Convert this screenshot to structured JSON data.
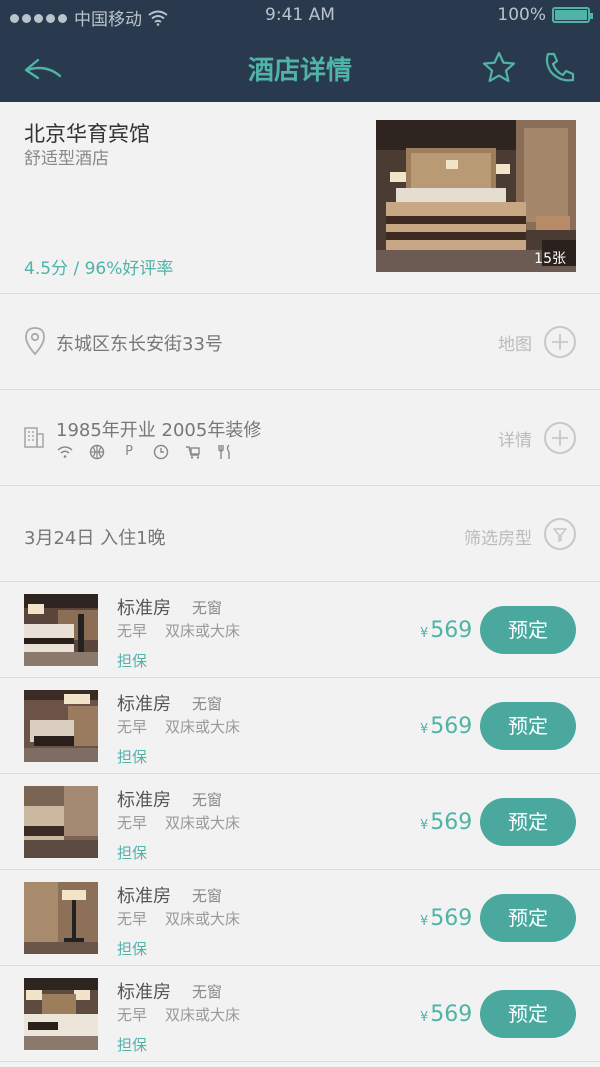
{
  "status_bar": {
    "carrier": "中国移动",
    "time": "9:41 AM",
    "battery": "100%"
  },
  "nav": {
    "title": "酒店详情",
    "back_icon": "back-arrow-icon",
    "favorite_icon": "star-icon",
    "call_icon": "phone-icon"
  },
  "hotel": {
    "name": "北京华育宾馆",
    "type": "舒适型酒店",
    "rating": "4.5分 / 96%好评率",
    "photo_count": "15张"
  },
  "address": {
    "text": "东城区东长安街33号",
    "action": "地图"
  },
  "facility": {
    "text": "1985年开业  2005年装修",
    "action": "详情",
    "amenities": [
      "wifi-icon",
      "globe-icon",
      "parking-icon",
      "clock-icon",
      "luggage-icon",
      "restaurant-icon"
    ],
    "parking_label": "P"
  },
  "filter": {
    "date_text": "3月24日  入住1晚",
    "action": "筛选房型"
  },
  "rooms": [
    {
      "name": "标准房",
      "window": "无窗",
      "meal": "无早",
      "bed": "双床或大床",
      "guarantee": "担保",
      "currency": "¥",
      "price": "569",
      "book": "预定"
    },
    {
      "name": "标准房",
      "window": "无窗",
      "meal": "无早",
      "bed": "双床或大床",
      "guarantee": "担保",
      "currency": "¥",
      "price": "569",
      "book": "预定"
    },
    {
      "name": "标准房",
      "window": "无窗",
      "meal": "无早",
      "bed": "双床或大床",
      "guarantee": "担保",
      "currency": "¥",
      "price": "569",
      "book": "预定"
    },
    {
      "name": "标准房",
      "window": "无窗",
      "meal": "无早",
      "bed": "双床或大床",
      "guarantee": "担保",
      "currency": "¥",
      "price": "569",
      "book": "预定"
    },
    {
      "name": "标准房",
      "window": "无窗",
      "meal": "无早",
      "bed": "双床或大床",
      "guarantee": "担保",
      "currency": "¥",
      "price": "569",
      "book": "预定"
    }
  ],
  "colors": {
    "header_bg": "#2a3a4e",
    "accent": "#4fb3a8",
    "button": "#4aa89f",
    "background": "#f2f2f2"
  }
}
